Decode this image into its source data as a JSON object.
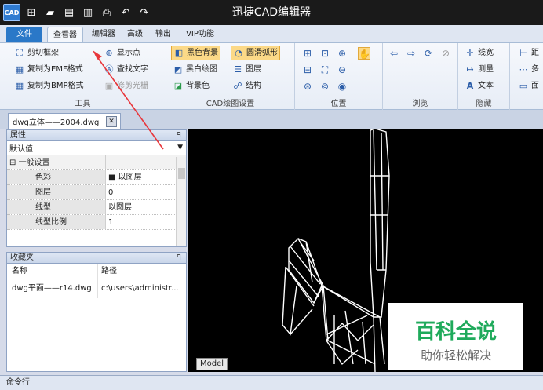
{
  "title": "迅捷CAD编辑器",
  "quick_access": {
    "logo": "CAD",
    "icons": [
      "new-icon",
      "open-icon",
      "save-icon",
      "save-as-icon",
      "print-icon",
      "undo-icon",
      "redo-icon"
    ]
  },
  "tabs": [
    "文件",
    "查看器",
    "编辑器",
    "高级",
    "输出",
    "VIP功能"
  ],
  "ribbon": {
    "tools": {
      "label": "工具",
      "items": [
        "剪切框架",
        "复制为EMF格式",
        "复制为BMP格式",
        "显示点",
        "查找文字",
        "修剪光栅"
      ]
    },
    "cad_settings": {
      "label": "CAD绘图设置",
      "items": [
        "黑色背景",
        "黑白绘图",
        "背景色",
        "圆滑弧形",
        "图层",
        "结构"
      ]
    },
    "position": {
      "label": "位置"
    },
    "browse": {
      "label": "浏览"
    },
    "hide": {
      "label": "隐藏",
      "items": [
        "线宽",
        "测量",
        "文本"
      ]
    },
    "more": {
      "items": [
        "距",
        "多",
        "面"
      ]
    }
  },
  "doc_tab": {
    "name": "dwg立体——2004.dwg"
  },
  "properties": {
    "title": "属性",
    "combo_value": "默认值",
    "section": "一般设置",
    "rows": [
      {
        "key": "色彩",
        "value": "■ 以图层"
      },
      {
        "key": "图层",
        "value": "0"
      },
      {
        "key": "线型",
        "value": "以图层"
      },
      {
        "key": "线型比例",
        "value": "1"
      }
    ]
  },
  "favorites": {
    "title": "收藏夹",
    "columns": [
      "名称",
      "路径"
    ],
    "rows": [
      {
        "name": "dwg平面——r14.dwg",
        "path": "c:\\users\\administr..."
      }
    ]
  },
  "model_tab": "Model",
  "command_label": "命令行",
  "watermark": {
    "line1": "百科全说",
    "line2": "助你轻松解决"
  },
  "colors": {
    "accent": "#2a78c8",
    "highlight": "#fcd987",
    "watermark": "#1faa5b"
  }
}
